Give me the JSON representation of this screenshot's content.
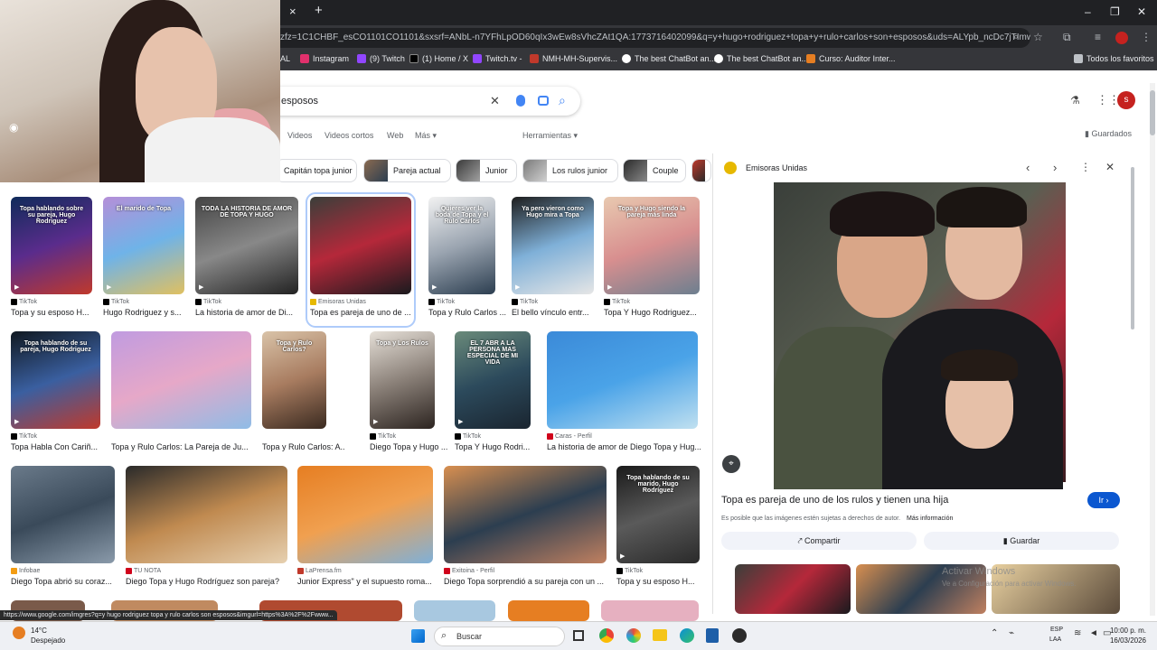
{
  "browser": {
    "url": "zfz=1C1CHBF_esCO1101CO1101&sxsrf=ANbL-n7YFhLpOD60qIx3wEw8sVhcZAt1QA:1773716402099&q=y+hugo+rodriguez+topa+y+rulo+carlos+son+esposos&uds=ALYpb_ncDc7jTImw6Mmq...",
    "new_tab": "+",
    "close_tab": "×",
    "bookmarks": [
      {
        "label": "AL",
        "color": "#8e8e8e"
      },
      {
        "label": "Instagram",
        "color": "#e1306c"
      },
      {
        "label": "(9) Twitch",
        "color": "#9146ff"
      },
      {
        "label": "(1) Home / X",
        "color": "#000000"
      },
      {
        "label": "Twitch.tv -",
        "color": "#9146ff"
      },
      {
        "label": "NMH-MH-Supervis...",
        "color": "#c0392b"
      },
      {
        "label": "The best ChatBot an...",
        "color": "#444444"
      },
      {
        "label": "The best ChatBot an...",
        "color": "#444444"
      },
      {
        "label": "Curso: Auditor Inter...",
        "color": "#e67e22"
      }
    ],
    "all_favorites": "Todos los favoritos"
  },
  "search": {
    "query": "esposos",
    "avatar_letter": "s",
    "saved": "Guardados",
    "tabs": [
      "Videos",
      "Videos cortos",
      "Web",
      "Más",
      "Herramientas"
    ],
    "chips": [
      "Capitán topa junior",
      "Pareja actual",
      "Junior",
      "Los rulos junior",
      "Couple"
    ]
  },
  "results": {
    "row1": [
      {
        "source": "TikTok",
        "title": "Topa y su esposo H...",
        "overlay": "Topa hablando sobre su pareja, Hugo Rodriguez",
        "bg": "linear-gradient(160deg,#0f2b5a,#5a2c8c,#c0392b)",
        "src_color": "#000000"
      },
      {
        "source": "TikTok",
        "title": "Hugo Rodriguez y s...",
        "overlay": "El marido de Topa",
        "bg": "linear-gradient(160deg,#b58fd8,#6fb3e8,#e0c060)",
        "src_color": "#000000"
      },
      {
        "source": "TikTok",
        "title": "La historia de amor de Di...",
        "overlay": "TODA LA HISTORIA DE AMOR DE TOPA Y HUGO",
        "bg": "linear-gradient(160deg,#444,#888,#222)",
        "src_color": "#000000"
      },
      {
        "source": "Emisoras Unidas",
        "title": "Topa es pareja de uno de ...",
        "overlay": "",
        "bg": "linear-gradient(160deg,#3a3f3a,#b5283a,#1a1a1e)",
        "src_color": "#e6b800"
      },
      {
        "source": "TikTok",
        "title": "Topa y Rulo Carlos ...",
        "overlay": "Quieres ver la boda de Topa y el Rulo Carlos",
        "bg": "linear-gradient(160deg,#f2f2f2,#9aa4b0,#2c3e50)",
        "src_color": "#000000"
      },
      {
        "source": "TikTok",
        "title": "El bello vínculo entr...",
        "overlay": "Ya pero vieron como Hugo mira a Topa",
        "bg": "linear-gradient(160deg,#1d1d1d,#7fb0d8,#e6e6e6)",
        "src_color": "#000000"
      },
      {
        "source": "TikTok",
        "title": "Topa Y Hugo Rodriguez...",
        "overlay": "Topa y Hugo siendo la pareja más linda",
        "bg": "linear-gradient(160deg,#e8c9b0,#d88f8f,#6d7f8f)",
        "src_color": "#000000"
      }
    ],
    "row2": [
      {
        "source": "TikTok",
        "title": "Topa Habla Con Cariñ...",
        "overlay": "Topa hablando de su pareja, Hugo Rodriguez",
        "bg": "linear-gradient(160deg,#101820,#3a5fa0,#c0392b)",
        "src_color": "#000000"
      },
      {
        "source": "",
        "title": "Topa y Rulo Carlos: La Pareja de Ju...",
        "overlay": "",
        "bg": "linear-gradient(160deg,#c09be0,#e6a8c8,#8fbce6)",
        "src_color": "#000000"
      },
      {
        "source": "",
        "title": "Topa y Rulo Carlos: A...",
        "overlay": "Topa y Rulo Carlos?",
        "bg": "linear-gradient(160deg,#d9c3a8,#a87c60,#3a2a20)",
        "src_color": "#000000"
      },
      {
        "source": "TikTok",
        "title": "Diego Topa y Hugo ...",
        "overlay": "Topa y Los Rulos",
        "bg": "linear-gradient(160deg,#e6e0d8,#8a8078,#2c2420)",
        "src_color": "#000000"
      },
      {
        "source": "TikTok",
        "title": "Topa Y Hugo Rodri...",
        "overlay": "EL 7 ABR A LA PERSONA MAS ESPECIAL DE MI VIDA",
        "bg": "linear-gradient(160deg,#6a8a7a,#2c4a5c,#1a2530)",
        "src_color": "#000000"
      },
      {
        "source": "Caras - Perfil",
        "title": "La historia de amor de Diego Topa y Hug...",
        "overlay": "",
        "bg": "linear-gradient(160deg,#3b8ad8,#4aa3e8,#c0e0f0)",
        "src_color": "#d0021b"
      }
    ],
    "row3": [
      {
        "source": "Infobae",
        "title": "Diego Topa abrió su coraz...",
        "overlay": "",
        "bg": "linear-gradient(160deg,#6a7a8a,#3a4a5a,#8a9aaa)",
        "src_color": "#f39c12"
      },
      {
        "source": "TU NOTA",
        "title": "Diego Topa y Hugo Rodríguez son pareja?",
        "overlay": "",
        "bg": "linear-gradient(160deg,#2a2a2a,#c08a50,#e6d0b0)",
        "src_color": "#d0021b"
      },
      {
        "source": "LaPrensa.fm",
        "title": "Junior Express\" y el supuesto roma...",
        "overlay": "",
        "bg": "linear-gradient(160deg,#e67e22,#f0a050,#7fb0d8)",
        "src_color": "#c0392b"
      },
      {
        "source": "Exitoina - Perfil",
        "title": "Diego Topa sorprendió a su pareja con un ...",
        "overlay": "",
        "bg": "linear-gradient(160deg,#d88f50,#2c3e50,#c08060)",
        "src_color": "#d0021b"
      },
      {
        "source": "TikTok",
        "title": "Topa y su esposo H...",
        "overlay": "Topa hablando de su marido, Hugo Rodríguez",
        "bg": "linear-gradient(160deg,#1a1a1a,#5a5a5a,#2a2a2a)",
        "src_color": "#000000"
      }
    ]
  },
  "panel": {
    "source": "Emisoras Unidas",
    "title": "Topa es pareja de uno de los rulos y tienen una hija",
    "go_button": "Ir",
    "rights_note": "Es posible que las imágenes estén sujetas a derechos de autor.",
    "more_info": "Más información",
    "share": "Compartir",
    "save": "Guardar",
    "watermark_1": "Activar Windows",
    "watermark_2": "Ve a Configuración para activar Windows."
  },
  "status_url": "https://www.google.com/imgres?q=y hugo rodriguez topa y rulo carlos son esposos&imgurl=https%3A%2F%2Fwww...",
  "taskbar": {
    "temperature": "14°C",
    "weather": "Despejado",
    "search": "Buscar",
    "lang_1": "ESP",
    "lang_2": "LAA",
    "time": "10:00 p. m.",
    "date": "16/03/2026"
  }
}
